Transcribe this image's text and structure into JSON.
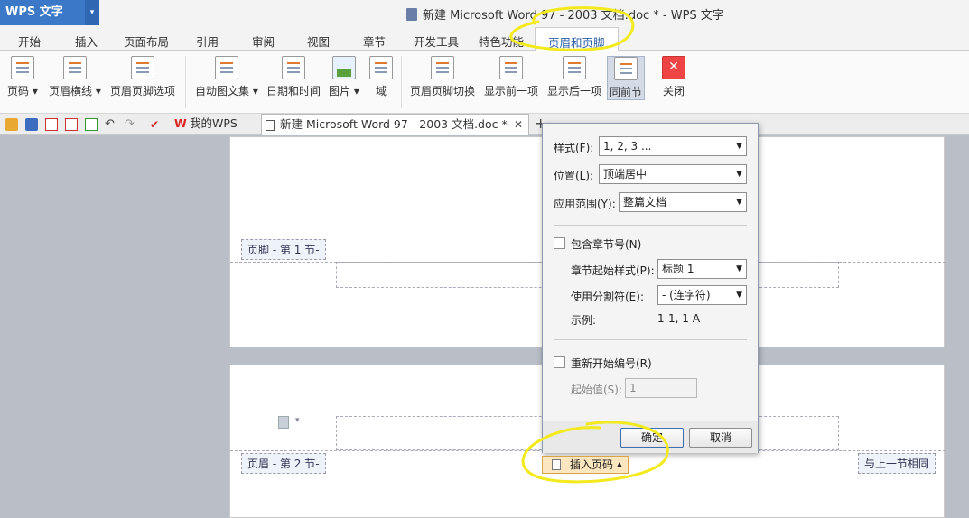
{
  "app": {
    "logo": "WPS 文字",
    "logo_arrow": "▾"
  },
  "window": {
    "title": "新建 Microsoft Word 97 - 2003 文档.doc * - WPS 文字"
  },
  "menu": {
    "items": [
      "开始",
      "插入",
      "页面布局",
      "引用",
      "审阅",
      "视图",
      "章节",
      "开发工具",
      "特色功能"
    ],
    "active": "页眉和页脚"
  },
  "ribbon": {
    "page_number": "页码",
    "header_line": "页眉横线",
    "hf_options": "页眉页脚选项",
    "auto_text": "自动图文集",
    "date_time": "日期和时间",
    "picture": "图片",
    "field": "域",
    "hf_switch": "页眉页脚切换",
    "show_prev": "显示前一项",
    "show_next": "显示后一项",
    "same_as_prev": "同前节",
    "close": "关闭"
  },
  "tabs": {
    "my_wps": "我的WPS",
    "doc": "新建 Microsoft Word 97 - 2003 文档.doc *",
    "close": "✕",
    "add": "+"
  },
  "document": {
    "footer_label": "页脚 - 第 1 节-",
    "header_label": "页眉 - 第 2 节-",
    "same_as_prev_label": "与上一节相同",
    "insert_page_number": "插入页码"
  },
  "dialog": {
    "style_label": "样式(F):",
    "style_value": "1, 2, 3 ...",
    "position_label": "位置(L):",
    "position_value": "顶端居中",
    "scope_label": "应用范围(Y):",
    "scope_value": "整篇文档",
    "include_chapter": "包含章节号(N)",
    "include_chapter_checked": false,
    "chapter_style_label": "章节起始样式(P):",
    "chapter_style_value": "标题 1",
    "separator_label": "使用分割符(E):",
    "separator_value": "-   (连字符)",
    "example_label": "示例:",
    "example_value": "1-1, 1-A",
    "restart_numbering": "重新开始编号(R)",
    "restart_checked": false,
    "start_value_label": "起始值(S):",
    "start_value": "1",
    "ok": "确定",
    "cancel": "取消"
  },
  "colors": {
    "accent": "#3c78c8",
    "highlight": "#f4ee2a"
  }
}
